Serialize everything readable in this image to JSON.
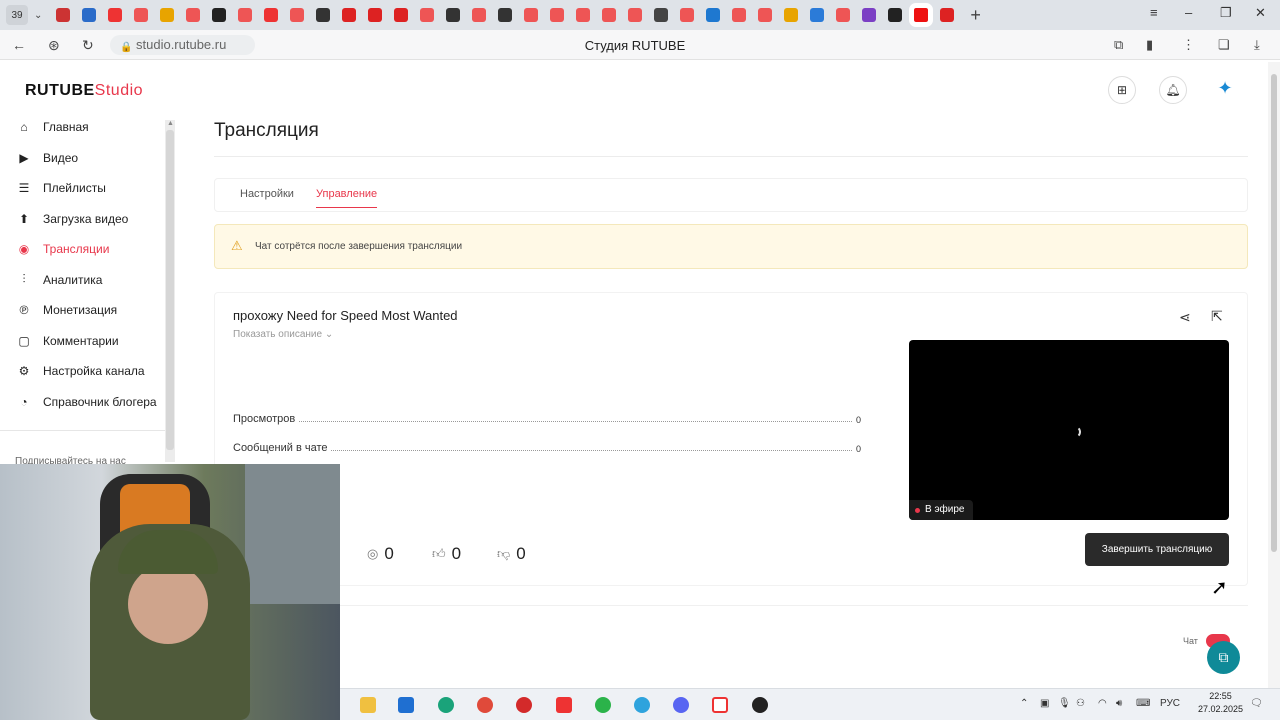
{
  "browser": {
    "tab_count": "39",
    "url": "studio.rutube.ru",
    "page_title": "Студия RUTUBE",
    "new_tab": "+"
  },
  "app": {
    "logo_main": "RUTUBE",
    "logo_suffix": "Studio"
  },
  "sidebar": {
    "items": [
      {
        "label": "Главная",
        "icon": "home-icon"
      },
      {
        "label": "Видео",
        "icon": "video-icon"
      },
      {
        "label": "Плейлисты",
        "icon": "playlist-icon"
      },
      {
        "label": "Загрузка видео",
        "icon": "upload-icon"
      },
      {
        "label": "Трансляции",
        "icon": "broadcast-icon",
        "active": true
      },
      {
        "label": "Аналитика",
        "icon": "analytics-icon"
      },
      {
        "label": "Монетизация",
        "icon": "money-icon"
      },
      {
        "label": "Комментарии",
        "icon": "comments-icon"
      },
      {
        "label": "Настройка канала",
        "icon": "channel-settings-icon"
      },
      {
        "label": "Справочник блогера",
        "icon": "help-book-icon"
      }
    ],
    "subscribe_text": "Подписывайтесь на нас"
  },
  "main": {
    "title": "Трансляция",
    "tabs": [
      {
        "label": "Настройки"
      },
      {
        "label": "Управление",
        "active": true
      }
    ],
    "notice": "Чат сотрётся после завершения трансляции",
    "stream": {
      "title": "прохожу Need for Speed Most Wanted",
      "show_description": "Показать описание",
      "stats": [
        {
          "label": "Просмотров",
          "value": "0"
        },
        {
          "label": "Сообщений в чате",
          "value": "0"
        }
      ],
      "live_badge": "В эфире",
      "viewers": "0",
      "likes": "0",
      "dislikes": "0",
      "end_button": "Завершить трансляцию"
    },
    "chat_label": "Чат"
  },
  "taskbar": {
    "lang": "РУС",
    "time": "22:55",
    "date": "27.02.2025"
  },
  "colors": {
    "accent": "#e8374b",
    "help_button": "#0f8a98"
  }
}
